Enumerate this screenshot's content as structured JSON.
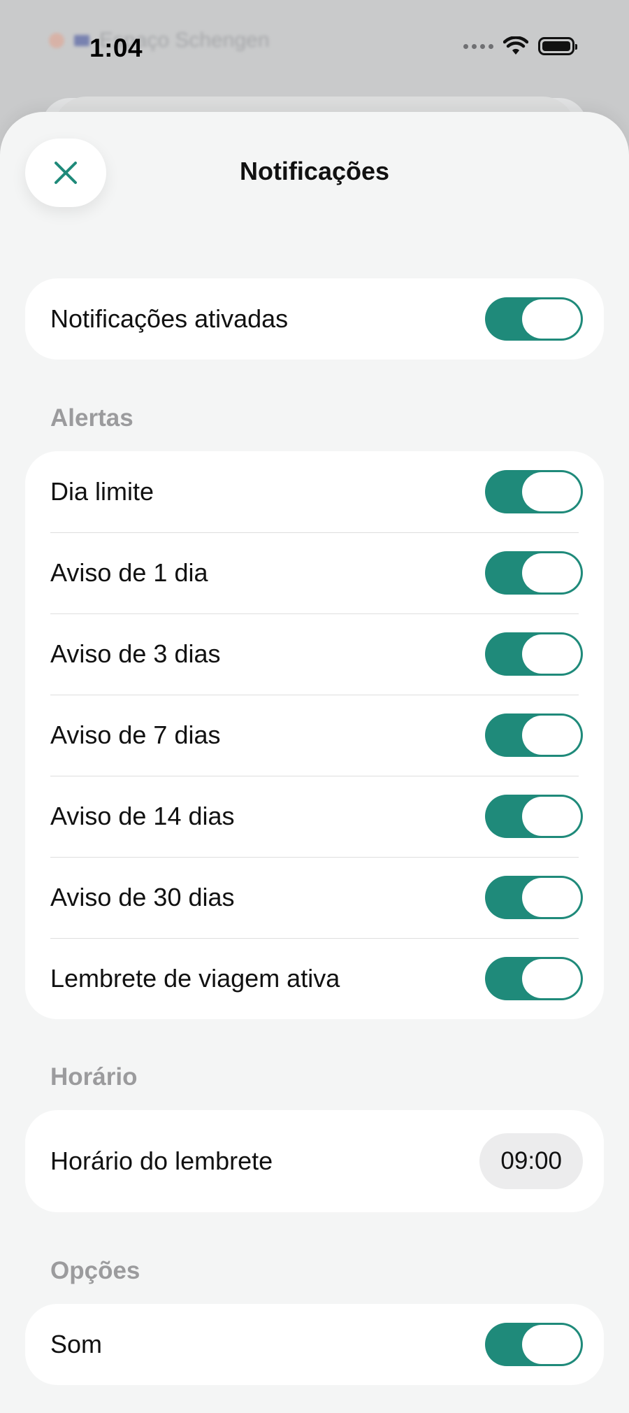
{
  "background": {
    "row1_text": "Espaço Schengen"
  },
  "status_bar": {
    "time": "1:04"
  },
  "sheet": {
    "title": "Notificações",
    "master": {
      "label": "Notificações ativadas",
      "enabled": true
    },
    "alerts": {
      "header": "Alertas",
      "items": [
        {
          "label": "Dia limite",
          "enabled": true
        },
        {
          "label": "Aviso de 1 dia",
          "enabled": true
        },
        {
          "label": "Aviso de 3 dias",
          "enabled": true
        },
        {
          "label": "Aviso de 7 dias",
          "enabled": true
        },
        {
          "label": "Aviso de 14 dias",
          "enabled": true
        },
        {
          "label": "Aviso de 30 dias",
          "enabled": true
        },
        {
          "label": "Lembrete de viagem ativa",
          "enabled": true
        }
      ]
    },
    "schedule": {
      "header": "Horário",
      "label": "Horário do lembrete",
      "value": "09:00"
    },
    "options": {
      "header": "Opções",
      "items": [
        {
          "label": "Som",
          "enabled": true
        }
      ]
    }
  },
  "colors": {
    "accent": "#1f8a7a",
    "sheet_bg": "#f4f5f5",
    "section_label": "#9b9b9d"
  },
  "icons": {
    "close": "close-icon",
    "wifi": "wifi-icon",
    "battery": "battery-icon"
  }
}
